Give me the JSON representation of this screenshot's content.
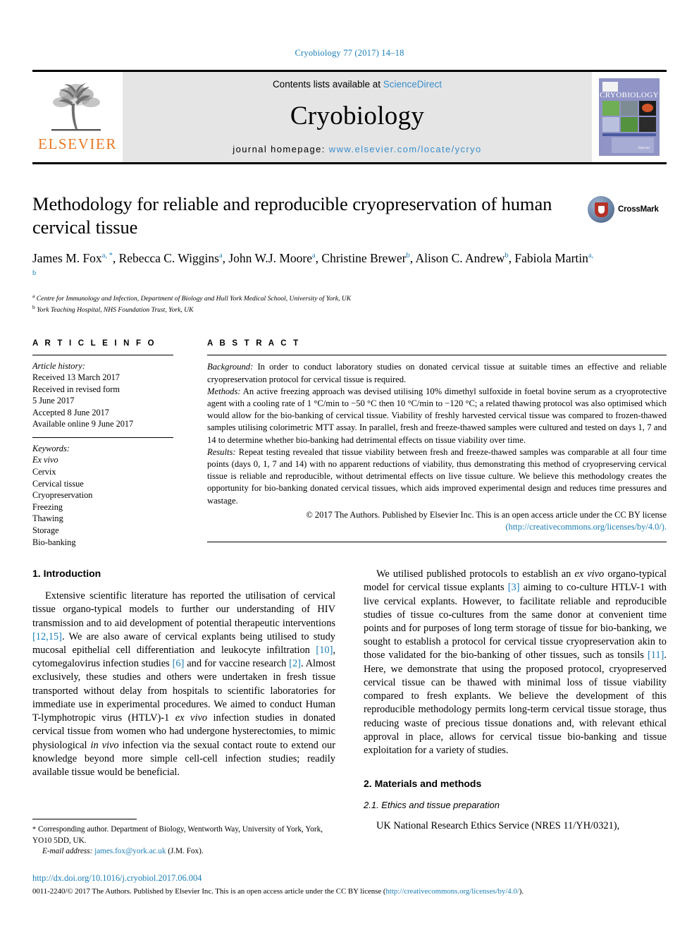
{
  "running_head": "Cryobiology 77 (2017) 14–18",
  "masthead": {
    "publisher_logo_text": "ELSEVIER",
    "contents_prefix": "Contents lists available at ",
    "contents_link": "ScienceDirect",
    "journal_name": "Cryobiology",
    "homepage_prefix": "journal homepage: ",
    "homepage_link": "www.elsevier.com/locate/ycryo",
    "cover_title": "CRYOBIOLOGY",
    "cover_publisher": "Elsevier"
  },
  "article": {
    "title": "Methodology for reliable and reproducible cryopreservation of human cervical tissue",
    "authors_line1": "James M. Fox",
    "authors_html_line1_rest": ", Rebecca C. Wiggins",
    "crossmark_label": "CrossMark",
    "authors": [
      {
        "name": "James M. Fox",
        "sup": "a, *"
      },
      {
        "name": "Rebecca C. Wiggins",
        "sup": "a"
      },
      {
        "name": "John W.J. Moore",
        "sup": "a"
      },
      {
        "name": "Christine Brewer",
        "sup": "b"
      },
      {
        "name": "Alison C. Andrew",
        "sup": "b"
      },
      {
        "name": "Fabiola Martin",
        "sup": "a, b"
      }
    ],
    "affiliations": [
      {
        "mark": "a",
        "text": "Centre for Immunology and Infection, Department of Biology and Hull York Medical School, University of York, UK"
      },
      {
        "mark": "b",
        "text": "York Teaching Hospital, NHS Foundation Trust, York, UK"
      }
    ]
  },
  "article_info": {
    "heading": "A R T I C L E  I N F O",
    "history_label": "Article history:",
    "history": [
      "Received 13 March 2017",
      "Received in revised form",
      "5 June 2017",
      "Accepted 8 June 2017",
      "Available online 9 June 2017"
    ],
    "keywords_label": "Keywords:",
    "keywords": [
      "Ex vivo",
      "Cervix",
      "Cervical tissue",
      "Cryopreservation",
      "Freezing",
      "Thawing",
      "Storage",
      "Bio-banking"
    ]
  },
  "abstract": {
    "heading": "A B S T R A C T",
    "background_label": "Background:",
    "background_text": " In order to conduct laboratory studies on donated cervical tissue at suitable times an effective and reliable cryopreservation protocol for cervical tissue is required.",
    "methods_label": "Methods:",
    "methods_text": " An active freezing approach was devised utilising 10% dimethyl sulfoxide in foetal bovine serum as a cryoprotective agent with a cooling rate of 1 °C/min to −50 °C then 10 °C/min to −120 °C; a related thawing protocol was also optimised which would allow for the bio-banking of cervical tissue. Viability of freshly harvested cervical tissue was compared to frozen-thawed samples utilising colorimetric MTT assay. In parallel, fresh and freeze-thawed samples were cultured and tested on days 1, 7 and 14 to determine whether bio-banking had detrimental effects on tissue viability over time.",
    "results_label": "Results:",
    "results_text": " Repeat testing revealed that tissue viability between fresh and freeze-thawed samples was comparable at all four time points (days 0, 1, 7 and 14) with no apparent reductions of viability, thus demonstrating this method of cryopreserving cervical tissue is reliable and reproducible, without detrimental effects on live tissue culture. We believe this methodology creates the opportunity for bio-banking donated cervical tissues, which aids improved experimental design and reduces time pressures and wastage.",
    "copyright_text": "© 2017 The Authors. Published by Elsevier Inc. This is an open access article under the CC BY license",
    "license_url": "(http://creativecommons.org/licenses/by/4.0/)."
  },
  "body": {
    "intro_heading": "1. Introduction",
    "intro_p1_a": "Extensive scientific literature has reported the utilisation of cervical tissue organo-typical models to further our understanding of HIV transmission and to aid development of potential therapeutic interventions ",
    "intro_ref1": "[12,15]",
    "intro_p1_b": ". We are also aware of cervical explants being utilised to study mucosal epithelial cell differentiation and leukocyte infiltration ",
    "intro_ref2": "[10]",
    "intro_p1_c": ", cytomegalovirus infection studies ",
    "intro_ref3": "[6]",
    "intro_p1_d": " and for vaccine research ",
    "intro_ref4": "[2]",
    "intro_p1_e": ". Almost exclusively, these studies and others were undertaken in fresh tissue transported without delay from hospitals to scientific laboratories for immediate use in experimental procedures. We aimed to conduct Human T-lymphotropic virus (HTLV)-1 ",
    "intro_p1_italic": "ex vivo",
    "intro_p1_f": " infection studies in donated cervical tissue from women who had undergone hysterectomies, to mimic physiological ",
    "intro_p1_italic2": "in vivo",
    "intro_p1_g": " infection via the sexual contact route to extend our knowledge beyond more simple cell-cell infection studies; readily available tissue would be beneficial.",
    "right_p1_a": "We utilised published protocols to establish an ",
    "right_p1_italic": "ex vivo",
    "right_p1_b": " organo-typical model for cervical tissue explants ",
    "right_ref1": "[3]",
    "right_p1_c": " aiming to co-culture HTLV-1 with live cervical explants. However, to facilitate reliable and reproducible studies of tissue co-cultures from the same donor at convenient time points and for purposes of long term storage of tissue for bio-banking, we sought to establish a protocol for cervical tissue cryopreservation akin to those validated for the bio-banking of other tissues, such as tonsils ",
    "right_ref2": "[11]",
    "right_p1_d": ". Here, we demonstrate that using the proposed protocol, cryopreserved cervical tissue can be thawed with minimal loss of tissue viability compared to fresh explants. We believe the development of this reproducible methodology permits long-term cervical tissue storage, thus reducing waste of precious tissue donations and, with relevant ethical approval in place, allows for cervical tissue bio-banking and tissue exploitation for a variety of studies.",
    "methods_heading": "2. Materials and methods",
    "ethics_heading": "2.1. Ethics and tissue preparation",
    "ethics_p1": "UK National Research Ethics Service (NRES 11/YH/0321),"
  },
  "footnotes": {
    "corresponding_star": "*",
    "corresponding_text": " Corresponding author. Department of Biology, Wentworth Way, University of York, York, YO10 5DD, UK.",
    "email_label": "E-mail address:",
    "email_address": "james.fox@york.ac.uk",
    "email_suffix": " (J.M. Fox)."
  },
  "footer": {
    "doi": "http://dx.doi.org/10.1016/j.cryobiol.2017.06.004",
    "issn_copy_a": "0011-2240/© 2017 The Authors. Published by Elsevier Inc. This is an open access article under the CC BY license (",
    "issn_copy_link": "http://creativecommons.org/licenses/by/4.0/",
    "issn_copy_b": ")."
  },
  "colors": {
    "link": "#1a7db6",
    "elsevier_orange": "#e87722",
    "masthead_bg": "#e5e5e5"
  }
}
